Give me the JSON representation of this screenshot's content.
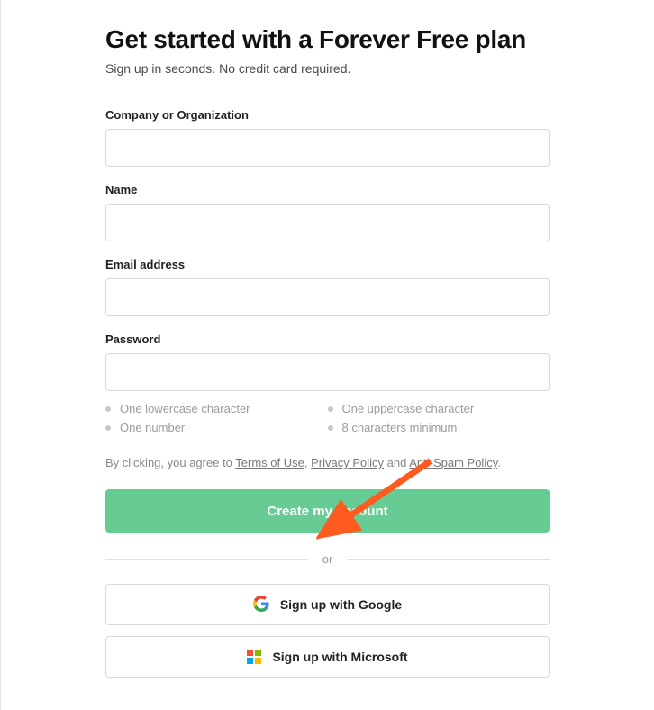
{
  "header": {
    "title": "Get started with a Forever Free plan",
    "subtitle": "Sign up in seconds. No credit card required."
  },
  "form": {
    "company_label": "Company or Organization",
    "company_value": "",
    "name_label": "Name",
    "name_value": "",
    "email_label": "Email address",
    "email_value": "",
    "password_label": "Password",
    "password_value": ""
  },
  "password_requirements": [
    "One lowercase character",
    "One uppercase character",
    "One number",
    "8 characters minimum"
  ],
  "legal": {
    "prefix": "By clicking, you agree to ",
    "terms": "Terms of Use",
    "comma1": ", ",
    "privacy": "Privacy Policy",
    "comma2": " and ",
    "antispam": "Anti-Spam Policy",
    "suffix": "."
  },
  "buttons": {
    "submit": "Create my account",
    "google": "Sign up with Google",
    "microsoft": "Sign up with Microsoft"
  },
  "divider": {
    "text": "or"
  }
}
